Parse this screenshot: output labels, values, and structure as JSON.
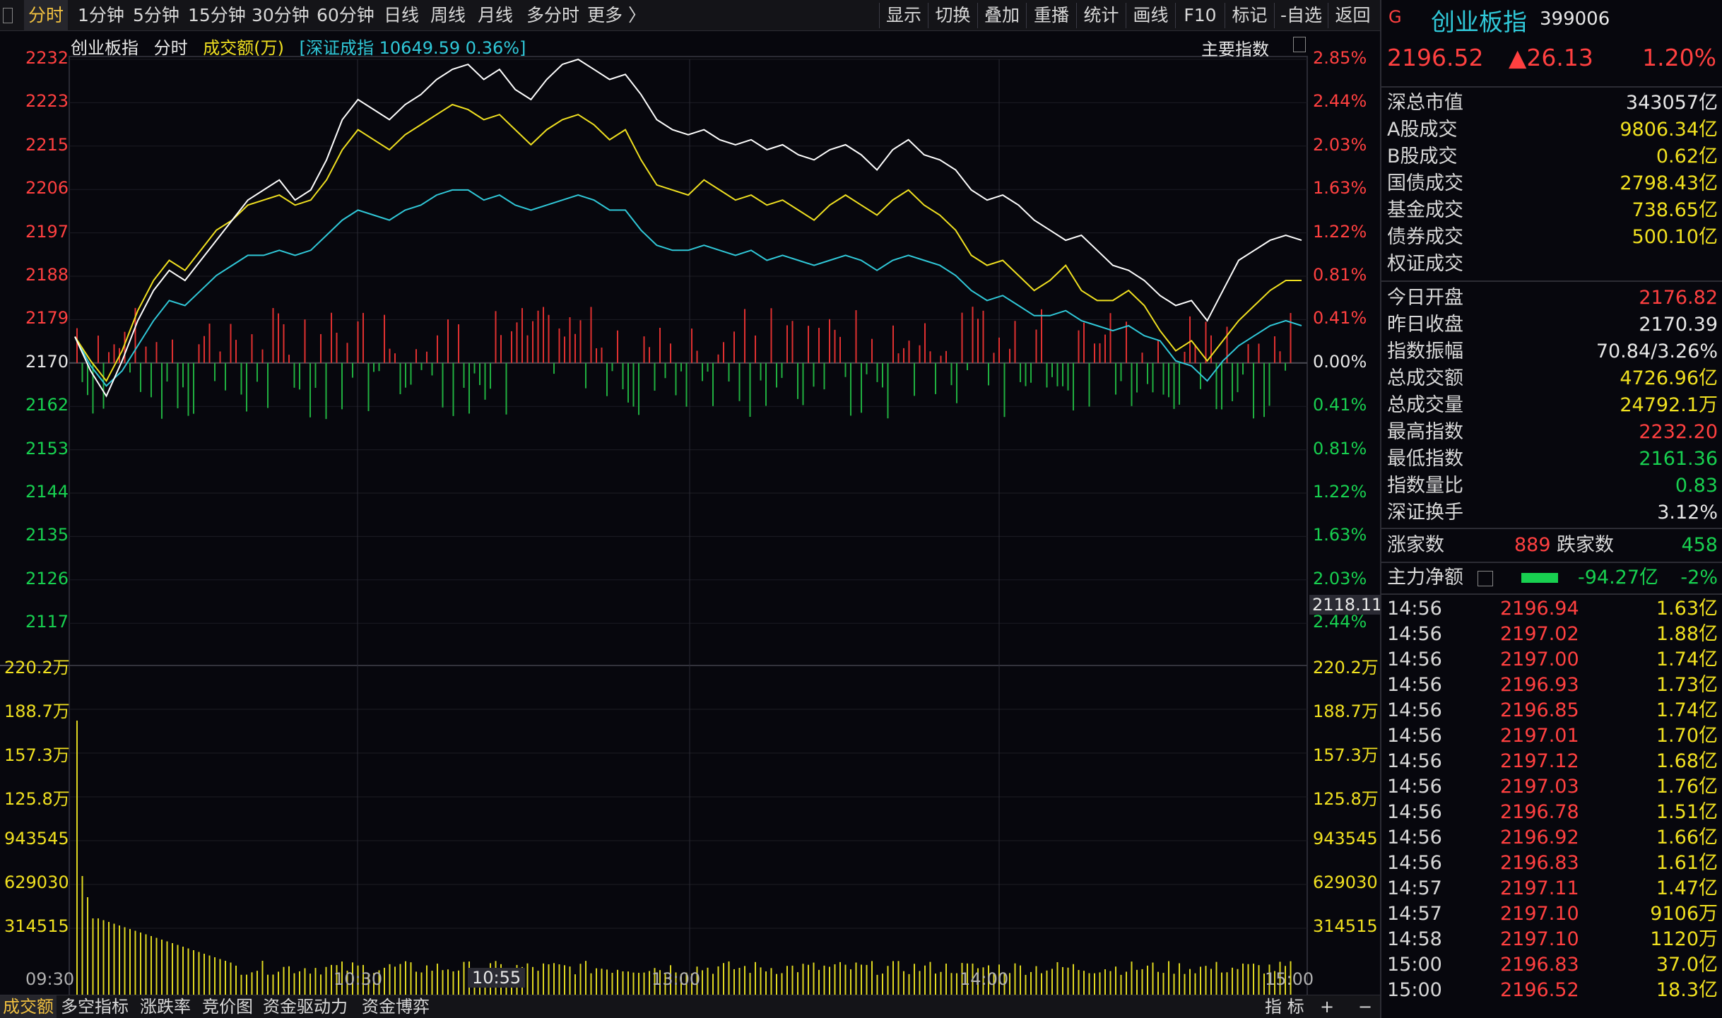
{
  "toolbar": {
    "period_tabs": [
      "分时",
      "1分钟",
      "5分钟",
      "15分钟",
      "30分钟",
      "60分钟",
      "日线",
      "周线",
      "月线",
      "多分时",
      "更多 〉"
    ],
    "tools": [
      "显示",
      "切换",
      "叠加",
      "重播",
      "统计",
      "画线",
      "F10",
      "标记",
      "-自选",
      "返回"
    ]
  },
  "chart_header": {
    "index_name": "创业板指",
    "mode": "分时",
    "volume_label": "成交额(万)",
    "overlay": "[深证成指 10649.59 0.36%]",
    "main_indicator": "主要指数"
  },
  "price_axis_left": [
    "2232",
    "2223",
    "2215",
    "2206",
    "2197",
    "2188",
    "2179",
    "2170",
    "2162",
    "2153",
    "2144",
    "2135",
    "2126",
    "2117"
  ],
  "price_axis_right": [
    "2.85%",
    "2.44%",
    "2.03%",
    "1.63%",
    "1.22%",
    "0.81%",
    "0.41%",
    "0.00%",
    "0.41%",
    "0.81%",
    "1.22%",
    "1.63%",
    "2.03%",
    "2.44%"
  ],
  "cursor_price": "2118.11",
  "volume_axis": [
    "220.2万",
    "188.7万",
    "157.3万",
    "125.8万",
    "943545",
    "629030",
    "314515"
  ],
  "time_axis": [
    "09:30",
    "10:30",
    "13:00",
    "14:00",
    "15:00"
  ],
  "cursor_time": "10:55",
  "bottom_tabs": [
    "成交额",
    "多空指标",
    "涨跌率",
    "竞价图",
    "资金驱动力",
    "资金博弈"
  ],
  "bottom_right": [
    "指 标",
    "+",
    "−"
  ],
  "quote": {
    "flag": "G",
    "name": "创业板指",
    "code": "399006",
    "price": "2196.52",
    "change": "▲26.13",
    "pct": "1.20%"
  },
  "stats_a": [
    {
      "k": "深总市值",
      "v": "343057亿",
      "c": "white"
    },
    {
      "k": "A股成交",
      "v": "9806.34亿",
      "c": "yellow"
    },
    {
      "k": "B股成交",
      "v": "0.62亿",
      "c": "yellow"
    },
    {
      "k": "国债成交",
      "v": "2798.43亿",
      "c": "yellow"
    },
    {
      "k": "基金成交",
      "v": "738.65亿",
      "c": "yellow"
    },
    {
      "k": "债券成交",
      "v": "500.10亿",
      "c": "yellow"
    },
    {
      "k": "权证成交",
      "v": "",
      "c": "yellow"
    }
  ],
  "stats_b": [
    {
      "k": "今日开盘",
      "v": "2176.82",
      "c": "red"
    },
    {
      "k": "昨日收盘",
      "v": "2170.39",
      "c": "white"
    },
    {
      "k": "指数振幅",
      "v": "70.84/3.26%",
      "c": "white"
    },
    {
      "k": "总成交额",
      "v": "4726.96亿",
      "c": "yellow"
    },
    {
      "k": "总成交量",
      "v": "24792.1万",
      "c": "yellow"
    },
    {
      "k": "最高指数",
      "v": "2232.20",
      "c": "red"
    },
    {
      "k": "最低指数",
      "v": "2161.36",
      "c": "green"
    },
    {
      "k": "指数量比",
      "v": "0.83",
      "c": "green"
    },
    {
      "k": "深证换手",
      "v": "3.12%",
      "c": "white"
    }
  ],
  "breadth": {
    "up_label": "涨家数",
    "up": "889",
    "down_label": "跌家数",
    "down": "458"
  },
  "net_flow": {
    "label": "主力净额",
    "value": "-94.27亿",
    "pct": "-2%"
  },
  "ticks": [
    {
      "t": "14:56",
      "p": "2196.94",
      "a": "1.63亿"
    },
    {
      "t": "14:56",
      "p": "2197.02",
      "a": "1.88亿"
    },
    {
      "t": "14:56",
      "p": "2197.00",
      "a": "1.74亿"
    },
    {
      "t": "14:56",
      "p": "2196.93",
      "a": "1.73亿"
    },
    {
      "t": "14:56",
      "p": "2196.85",
      "a": "1.74亿"
    },
    {
      "t": "14:56",
      "p": "2197.01",
      "a": "1.70亿"
    },
    {
      "t": "14:56",
      "p": "2197.12",
      "a": "1.68亿"
    },
    {
      "t": "14:56",
      "p": "2197.03",
      "a": "1.76亿"
    },
    {
      "t": "14:56",
      "p": "2196.78",
      "a": "1.51亿"
    },
    {
      "t": "14:56",
      "p": "2196.92",
      "a": "1.66亿"
    },
    {
      "t": "14:56",
      "p": "2196.83",
      "a": "1.61亿"
    },
    {
      "t": "14:57",
      "p": "2197.11",
      "a": "1.47亿"
    },
    {
      "t": "14:57",
      "p": "2197.10",
      "a": "9106万"
    },
    {
      "t": "14:58",
      "p": "2197.10",
      "a": "1120万"
    },
    {
      "t": "15:00",
      "p": "2196.83",
      "a": "37.0亿"
    },
    {
      "t": "15:00",
      "p": "2196.52",
      "a": "18.3亿"
    }
  ],
  "colors": {
    "price_line": "#ffffff",
    "avg_line": "#f0e020",
    "overlay_line": "#30c8d8",
    "up_bar": "#e03030",
    "down_bar": "#20b040",
    "volume_bar": "#e0d820"
  },
  "chart_data": {
    "type": "line",
    "yrange": [
      2117,
      2232
    ],
    "prev_close": 2170.39,
    "price": [
      2176.8,
      2170,
      2165,
      2172,
      2180,
      2186,
      2190,
      2188,
      2192,
      2196,
      2200,
      2204,
      2206,
      2208,
      2204,
      2206,
      2212,
      2220,
      2224,
      2222,
      2220,
      2223,
      2225,
      2228,
      2230,
      2231,
      2228,
      2230,
      2226,
      2224,
      2228,
      2231,
      2232,
      2230,
      2228,
      2229,
      2225,
      2220,
      2218,
      2217,
      2218,
      2216,
      2215,
      2216,
      2214,
      2215,
      2213,
      2212,
      2214,
      2215,
      2213,
      2210,
      2214,
      2216,
      2213,
      2212,
      2210,
      2206,
      2204,
      2205,
      2203,
      2200,
      2198,
      2196,
      2197,
      2194,
      2191,
      2190,
      2188,
      2185,
      2183,
      2184,
      2180,
      2186,
      2192,
      2194,
      2196,
      2197,
      2196
    ],
    "avg": [
      2176.8,
      2172,
      2168,
      2174,
      2182,
      2188,
      2192,
      2190,
      2194,
      2198,
      2200,
      2203,
      2204,
      2205,
      2203,
      2204,
      2208,
      2214,
      2218,
      2216,
      2214,
      2217,
      2219,
      2221,
      2223,
      2222,
      2220,
      2221,
      2218,
      2215,
      2218,
      2220,
      2221,
      2219,
      2216,
      2218,
      2212,
      2207,
      2206,
      2205,
      2208,
      2206,
      2204,
      2205,
      2203,
      2204,
      2202,
      2200,
      2203,
      2205,
      2203,
      2201,
      2204,
      2206,
      2203,
      2201,
      2198,
      2193,
      2191,
      2192,
      2189,
      2186,
      2188,
      2191,
      2186,
      2184,
      2184,
      2186,
      2183,
      2178,
      2174,
      2176,
      2172,
      2176,
      2180,
      2183,
      2186,
      2188,
      2188
    ],
    "overlay": [
      2176.8,
      2171,
      2167,
      2170,
      2175,
      2180,
      2184,
      2183,
      2186,
      2189,
      2191,
      2193,
      2193,
      2194,
      2193,
      2194,
      2197,
      2200,
      2202,
      2201,
      2200,
      2202,
      2203,
      2205,
      2206,
      2206,
      2204,
      2205,
      2203,
      2202,
      2203,
      2204,
      2205,
      2204,
      2202,
      2202,
      2198,
      2195,
      2194,
      2194,
      2195,
      2194,
      2193,
      2194,
      2192,
      2193,
      2192,
      2191,
      2192,
      2193,
      2192,
      2190,
      2192,
      2193,
      2192,
      2191,
      2189,
      2186,
      2184,
      2185,
      2183,
      2181,
      2181,
      2182,
      2180,
      2179,
      2178,
      2179,
      2177,
      2176,
      2172,
      2171,
      2168,
      2172,
      2175,
      2177,
      2179,
      2180,
      2179
    ]
  }
}
